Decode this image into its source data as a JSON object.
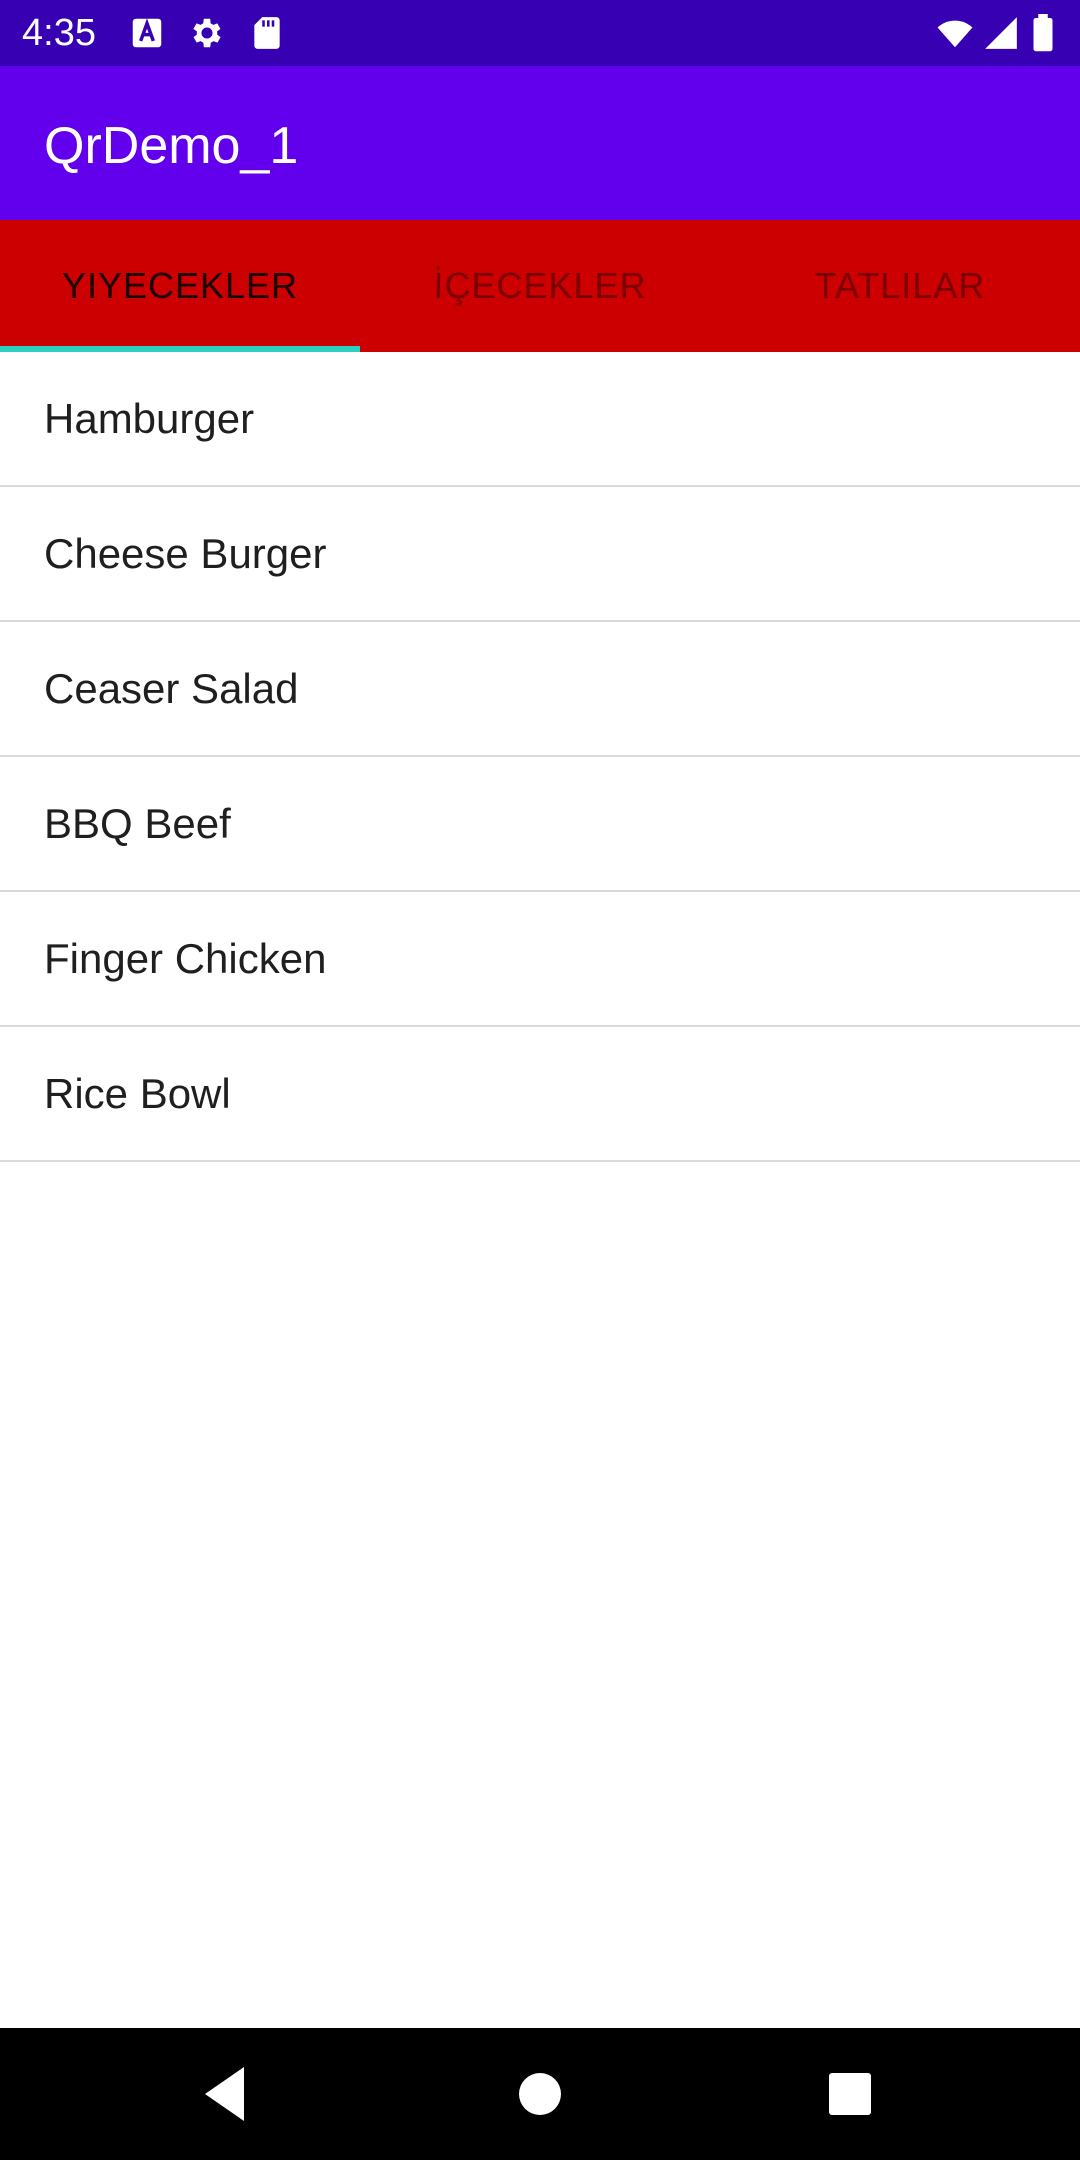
{
  "status_bar": {
    "time": "4:35",
    "left_icons": [
      "font-a-icon",
      "gear-icon",
      "sd-card-icon"
    ],
    "right_icons": [
      "wifi-icon",
      "cell-signal-icon",
      "battery-icon"
    ],
    "background": "#3700b3"
  },
  "app_bar": {
    "title": "QrDemo_1",
    "background": "#6200ee"
  },
  "tabs": {
    "background": "#cc0000",
    "indicator_color": "#2ad1c0",
    "items": [
      {
        "label": "YIYECEKLER",
        "selected": true
      },
      {
        "label": "İÇECEKLER",
        "selected": false
      },
      {
        "label": "TATLILAR",
        "selected": false
      }
    ]
  },
  "list": {
    "items": [
      {
        "label": "Hamburger"
      },
      {
        "label": "Cheese Burger"
      },
      {
        "label": "Ceaser Salad"
      },
      {
        "label": "BBQ Beef"
      },
      {
        "label": "Finger Chicken"
      },
      {
        "label": "Rice Bowl"
      }
    ]
  },
  "nav_bar": {
    "buttons": [
      "back-icon",
      "home-icon",
      "recents-icon"
    ]
  }
}
